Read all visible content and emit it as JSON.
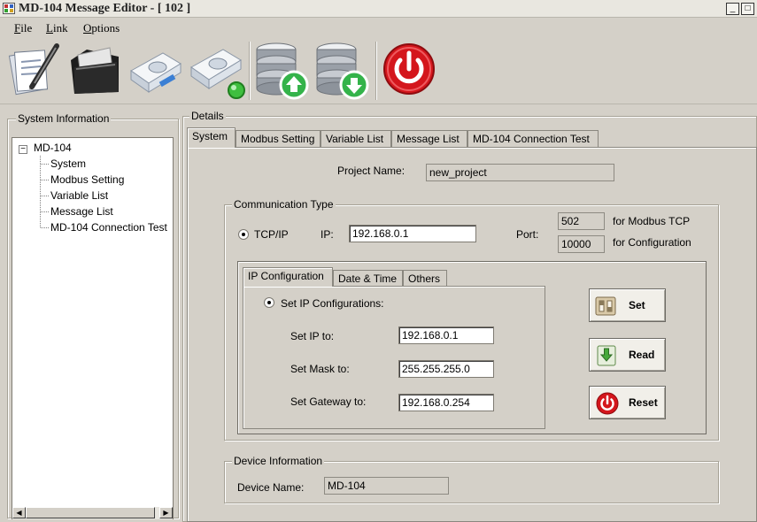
{
  "window": {
    "title": "MD-104 Message Editor - [ 102 ]",
    "minimize": "_",
    "maximize": "□"
  },
  "menu": [
    {
      "pre": "",
      "u": "F",
      "post": "ile"
    },
    {
      "pre": "",
      "u": "L",
      "post": "ink"
    },
    {
      "pre": "",
      "u": "O",
      "post": "ptions"
    }
  ],
  "toolbar": {
    "icons": [
      "new-document-icon",
      "open-folder-icon",
      "disconnected-device-icon",
      "connected-device-icon",
      "upload-database-icon",
      "download-database-icon",
      "power-exit-icon"
    ]
  },
  "sidebar": {
    "title": "System Information",
    "root": "MD-104",
    "expander": "−",
    "items": [
      "System",
      "Modbus Setting",
      "Variable List",
      "Message List",
      "MD-104 Connection Test"
    ],
    "scroll_left": "◀",
    "scroll_right": "▶"
  },
  "details": {
    "title": "Details",
    "tabs": [
      "System",
      "Modbus Setting",
      "Variable List",
      "Message List",
      "MD-104 Connection Test"
    ],
    "project_name_label": "Project Name:",
    "project_name_value": "new_project",
    "comm": {
      "title": "Communication Type",
      "tcpip_label": "TCP/IP",
      "ip_label": "IP:",
      "ip_value": "192.168.0.1",
      "port_label": "Port:",
      "port_modbus": "502",
      "port_modbus_note": "for Modbus TCP",
      "port_config": "10000",
      "port_config_note": "for Configuration"
    },
    "inner_tabs": [
      "IP Configuration",
      "Date & Time",
      "Others"
    ],
    "ipconf": {
      "radio_label": "Set IP Configurations:",
      "ip_label": "Set IP to:",
      "ip_value": "192.168.0.1",
      "mask_label": "Set Mask to:",
      "mask_value": "255.255.255.0",
      "gateway_label": "Set Gateway to:",
      "gateway_value": "192.168.0.254"
    },
    "buttons": {
      "set": "Set",
      "read": "Read",
      "reset": "Reset"
    },
    "device": {
      "title": "Device Information",
      "name_label": "Device Name:",
      "name_value": "MD-104"
    }
  }
}
